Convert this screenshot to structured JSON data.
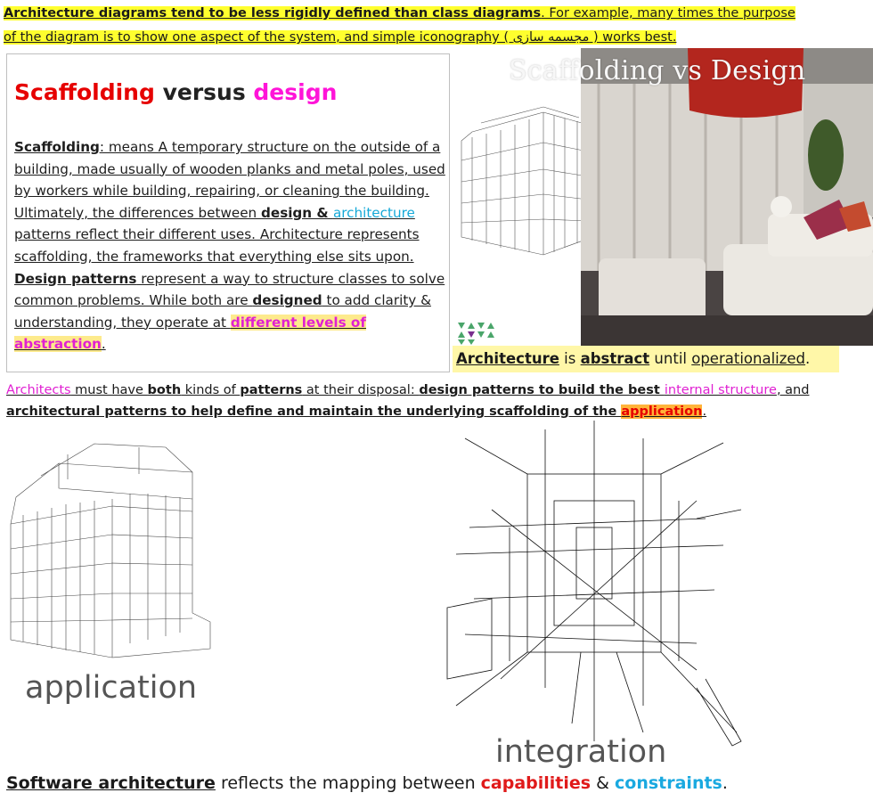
{
  "banner": {
    "lead": "Architecture diagrams tend to be less rigidly defined than class diagrams",
    "rest1": ". For example, many times the purpose",
    "line2": "of the diagram is to show one aspect of the system, and simple iconography ( مجسمه سازی ) works best."
  },
  "card": {
    "title_part1": "Scaffolding",
    "title_part2": " versus ",
    "title_part3": "design",
    "t1": "Scaffolding",
    "t2": ": means A temporary structure on the outside of a building, made usually of wooden planks and metal poles, used by workers while building, repairing, or cleaning the building. Ultimately, the differences between ",
    "t3": "design & ",
    "t4": "architecture",
    "t5": " patterns reflect their different uses. Architecture represents scaffolding, the frameworks that everything else sits upon. ",
    "t6": "Design patterns",
    "t7": " represent a way to structure classes to solve common problems. While both are ",
    "t8": "designed",
    "t9": " to add clarity & understanding, they operate at ",
    "t10": "different levels of abstraction",
    "t11": "."
  },
  "photo": {
    "title": "Scaffolding vs Design"
  },
  "abstract_line": {
    "a": "Architecture",
    "b": " is ",
    "c": "abstract",
    "d": " until ",
    "e": "operationalized",
    "f": "."
  },
  "architects": {
    "a": "Architects",
    "b": " must have ",
    "c": "both",
    "d": " kinds of ",
    "e": "patterns",
    "f": " at their disposal: ",
    "g": "design patterns to build the best ",
    "h": "internal structure",
    "i": ", and",
    "j": "architectural patterns to help define and maintain the underlying scaffolding of the ",
    "k": "application",
    "l": "."
  },
  "labels": {
    "application": "application",
    "integration": "integration"
  },
  "bottom": {
    "a": "Software architecture",
    "b": " reflects the mapping between ",
    "c": "capabilities",
    "d": " & ",
    "e": "constraints",
    "f": "."
  },
  "colors": {
    "highlight_yellow": "#ffff2e",
    "red": "#e60000",
    "magenta": "#ff14d8",
    "cyan": "#14a9d8"
  }
}
